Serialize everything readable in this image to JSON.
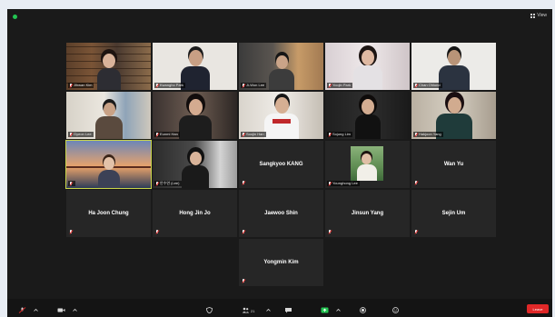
{
  "window": {
    "view_label": "View",
    "accent_active": "#c9d64a",
    "mute_color": "#e02828",
    "leave_color": "#e02828"
  },
  "participants": [
    {
      "label": "Jihwan Kim",
      "video": true
    },
    {
      "label": "Kwangho Park",
      "video": true
    },
    {
      "label": "Ji-Won Lee",
      "video": true
    },
    {
      "label": "Yoojin Park",
      "video": true
    },
    {
      "label": "Chan Ohlund",
      "video": true
    },
    {
      "label": "Gyeon Lee",
      "video": true
    },
    {
      "label": "Eunmi Han",
      "video": true
    },
    {
      "label": "Soojin Han",
      "video": true
    },
    {
      "label": "Sojung Lim",
      "video": true
    },
    {
      "label": "Hakjoon Yang",
      "video": true
    },
    {
      "label": "",
      "video": true
    },
    {
      "label": "안수연 (Lee)",
      "video": true
    },
    {
      "name": "Sangkyoo KANG",
      "video": false
    },
    {
      "label": "Younghong Lee",
      "video": true
    },
    {
      "name": "Wan Yu",
      "video": false
    },
    {
      "name": "Ha Joon Chung",
      "video": false
    },
    {
      "name": "Hong Jin Jo",
      "video": false
    },
    {
      "name": "Jaewoo Shin",
      "video": false
    },
    {
      "name": "Jinsun Yang",
      "video": false
    },
    {
      "name": "Sejin Um",
      "video": false
    },
    {
      "name": "Yongmin Kim",
      "video": false
    }
  ],
  "toolbar": {
    "participants_count": "21",
    "leave_label": "Leave"
  }
}
